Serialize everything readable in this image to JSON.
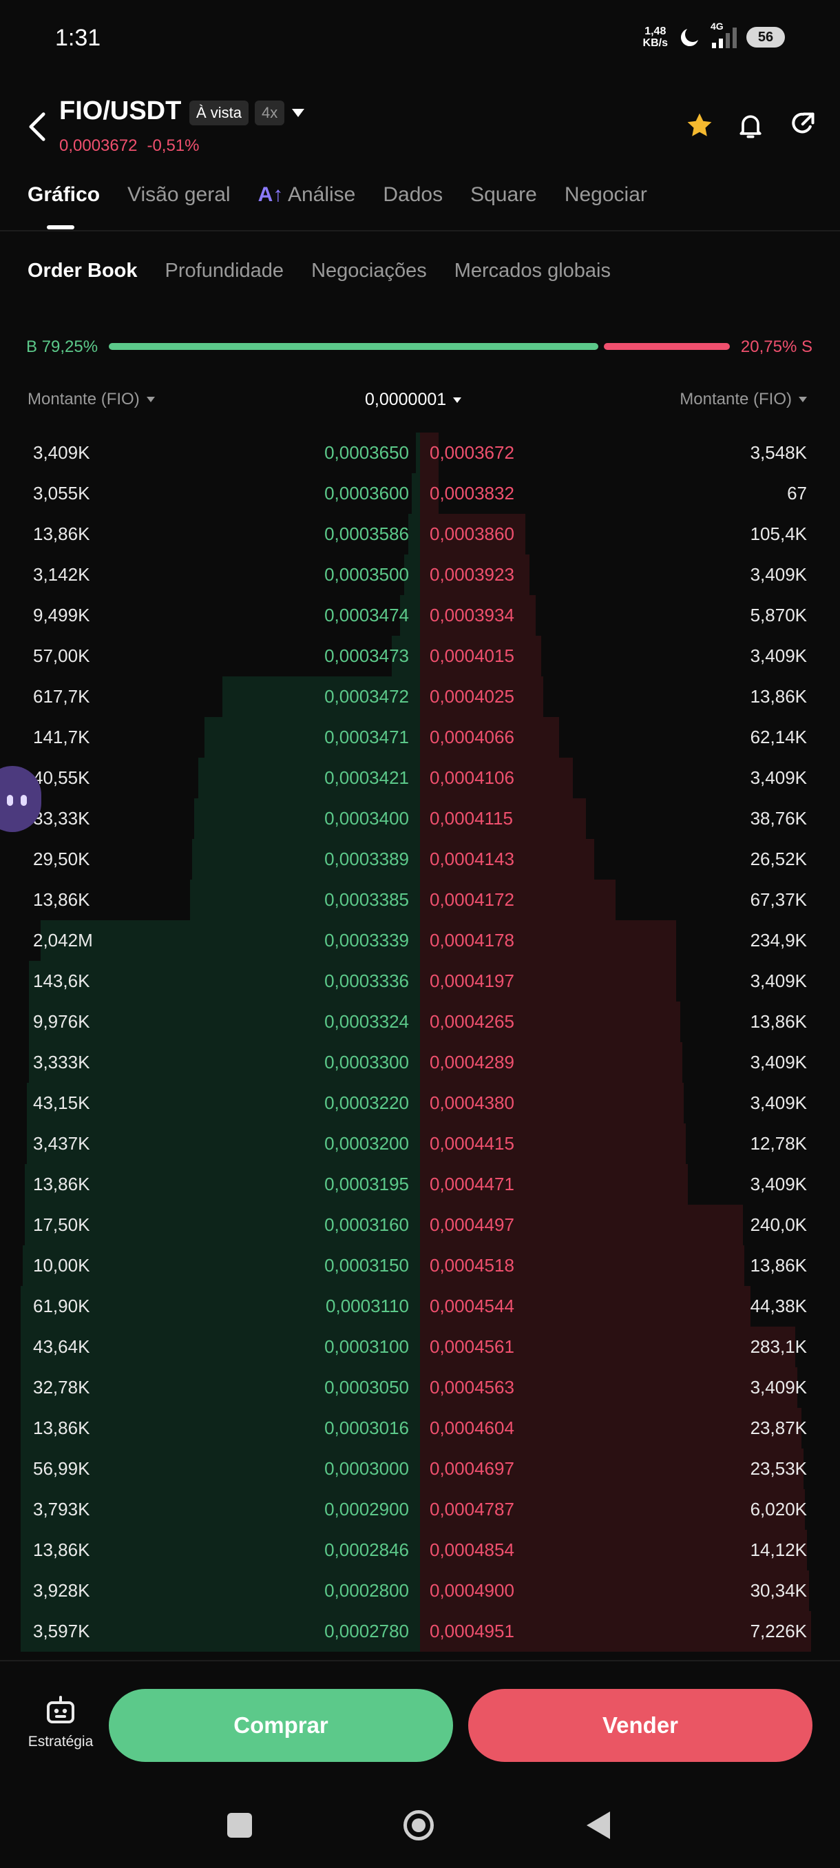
{
  "status_bar": {
    "time": "1:31",
    "net_speed_value": "1,48",
    "net_speed_unit": "KB/s",
    "network": "4G",
    "battery": "56",
    "icons": [
      "moon-icon",
      "signal-icon",
      "battery-icon"
    ]
  },
  "header": {
    "pair": "FIO/USDT",
    "market_badge": "À vista",
    "leverage_badge": "4x",
    "last_price": "0,0003672",
    "change": "-0,51%",
    "icons": [
      "back-icon",
      "star-icon",
      "bell-icon",
      "share-icon"
    ],
    "star_color": "#f5b92f"
  },
  "main_tabs": [
    {
      "label": "Gráfico",
      "active": true
    },
    {
      "label": "Visão geral",
      "active": false
    },
    {
      "label": "Análise",
      "active": false,
      "ai_prefix": "A↑"
    },
    {
      "label": "Dados",
      "active": false
    },
    {
      "label": "Square",
      "active": false
    },
    {
      "label": "Negociar",
      "active": false
    }
  ],
  "sub_tabs": [
    {
      "label": "Order Book",
      "active": true
    },
    {
      "label": "Profundidade",
      "active": false
    },
    {
      "label": "Negociações",
      "active": false
    },
    {
      "label": "Mercados globais",
      "active": false
    }
  ],
  "ratio": {
    "buy_label": "B 79,25%",
    "sell_label": "20,75% S",
    "buy_fraction": 0.7925
  },
  "columns": {
    "left": "Montante (FIO)",
    "precision": "0,0000001",
    "right": "Montante (FIO)"
  },
  "order_book": {
    "rows": [
      {
        "bid_amount": "3,409K",
        "bid_price": "0,0003650",
        "ask_price": "0,0003672",
        "ask_amount": "3,548K",
        "bid_depth": 0.01,
        "ask_depth": 0.048
      },
      {
        "bid_amount": "3,055K",
        "bid_price": "0,0003600",
        "ask_price": "0,0003832",
        "ask_amount": "67",
        "bid_depth": 0.02,
        "ask_depth": 0.048
      },
      {
        "bid_amount": "13,86K",
        "bid_price": "0,0003586",
        "ask_price": "0,0003860",
        "ask_amount": "105,4K",
        "bid_depth": 0.03,
        "ask_depth": 0.27
      },
      {
        "bid_amount": "3,142K",
        "bid_price": "0,0003500",
        "ask_price": "0,0003923",
        "ask_amount": "3,409K",
        "bid_depth": 0.04,
        "ask_depth": 0.28
      },
      {
        "bid_amount": "9,499K",
        "bid_price": "0,0003474",
        "ask_price": "0,0003934",
        "ask_amount": "5,870K",
        "bid_depth": 0.05,
        "ask_depth": 0.295
      },
      {
        "bid_amount": "57,00K",
        "bid_price": "0,0003473",
        "ask_price": "0,0004015",
        "ask_amount": "3,409K",
        "bid_depth": 0.07,
        "ask_depth": 0.31
      },
      {
        "bid_amount": "617,7K",
        "bid_price": "0,0003472",
        "ask_price": "0,0004025",
        "ask_amount": "13,86K",
        "bid_depth": 0.495,
        "ask_depth": 0.315
      },
      {
        "bid_amount": "141,7K",
        "bid_price": "0,0003471",
        "ask_price": "0,0004066",
        "ask_amount": "62,14K",
        "bid_depth": 0.54,
        "ask_depth": 0.355
      },
      {
        "bid_amount": "40,55K",
        "bid_price": "0,0003421",
        "ask_price": "0,0004106",
        "ask_amount": "3,409K",
        "bid_depth": 0.555,
        "ask_depth": 0.39
      },
      {
        "bid_amount": "33,33K",
        "bid_price": "0,0003400",
        "ask_price": "0,0004115",
        "ask_amount": "38,76K",
        "bid_depth": 0.565,
        "ask_depth": 0.425
      },
      {
        "bid_amount": "29,50K",
        "bid_price": "0,0003389",
        "ask_price": "0,0004143",
        "ask_amount": "26,52K",
        "bid_depth": 0.57,
        "ask_depth": 0.445
      },
      {
        "bid_amount": "13,86K",
        "bid_price": "0,0003385",
        "ask_price": "0,0004172",
        "ask_amount": "67,37K",
        "bid_depth": 0.575,
        "ask_depth": 0.5
      },
      {
        "bid_amount": "2,042M",
        "bid_price": "0,0003339",
        "ask_price": "0,0004178",
        "ask_amount": "234,9K",
        "bid_depth": 0.95,
        "ask_depth": 0.655
      },
      {
        "bid_amount": "143,6K",
        "bid_price": "0,0003336",
        "ask_price": "0,0004197",
        "ask_amount": "3,409K",
        "bid_depth": 0.98,
        "ask_depth": 0.655
      },
      {
        "bid_amount": "9,976K",
        "bid_price": "0,0003324",
        "ask_price": "0,0004265",
        "ask_amount": "13,86K",
        "bid_depth": 0.98,
        "ask_depth": 0.665
      },
      {
        "bid_amount": "3,333K",
        "bid_price": "0,0003300",
        "ask_price": "0,0004289",
        "ask_amount": "3,409K",
        "bid_depth": 0.98,
        "ask_depth": 0.67
      },
      {
        "bid_amount": "43,15K",
        "bid_price": "0,0003220",
        "ask_price": "0,0004380",
        "ask_amount": "3,409K",
        "bid_depth": 0.985,
        "ask_depth": 0.675
      },
      {
        "bid_amount": "3,437K",
        "bid_price": "0,0003200",
        "ask_price": "0,0004415",
        "ask_amount": "12,78K",
        "bid_depth": 0.985,
        "ask_depth": 0.68
      },
      {
        "bid_amount": "13,86K",
        "bid_price": "0,0003195",
        "ask_price": "0,0004471",
        "ask_amount": "3,409K",
        "bid_depth": 0.99,
        "ask_depth": 0.685
      },
      {
        "bid_amount": "17,50K",
        "bid_price": "0,0003160",
        "ask_price": "0,0004497",
        "ask_amount": "240,0K",
        "bid_depth": 0.99,
        "ask_depth": 0.825
      },
      {
        "bid_amount": "10,00K",
        "bid_price": "0,0003150",
        "ask_price": "0,0004518",
        "ask_amount": "13,86K",
        "bid_depth": 0.995,
        "ask_depth": 0.83
      },
      {
        "bid_amount": "61,90K",
        "bid_price": "0,0003110",
        "ask_price": "0,0004544",
        "ask_amount": "44,38K",
        "bid_depth": 1.0,
        "ask_depth": 0.845
      },
      {
        "bid_amount": "43,64K",
        "bid_price": "0,0003100",
        "ask_price": "0,0004561",
        "ask_amount": "283,1K",
        "bid_depth": 1.0,
        "ask_depth": 0.96
      },
      {
        "bid_amount": "32,78K",
        "bid_price": "0,0003050",
        "ask_price": "0,0004563",
        "ask_amount": "3,409K",
        "bid_depth": 1.0,
        "ask_depth": 0.965
      },
      {
        "bid_amount": "13,86K",
        "bid_price": "0,0003016",
        "ask_price": "0,0004604",
        "ask_amount": "23,87K",
        "bid_depth": 1.0,
        "ask_depth": 0.975
      },
      {
        "bid_amount": "56,99K",
        "bid_price": "0,0003000",
        "ask_price": "0,0004697",
        "ask_amount": "23,53K",
        "bid_depth": 1.0,
        "ask_depth": 0.98
      },
      {
        "bid_amount": "3,793K",
        "bid_price": "0,0002900",
        "ask_price": "0,0004787",
        "ask_amount": "6,020K",
        "bid_depth": 1.0,
        "ask_depth": 0.985
      },
      {
        "bid_amount": "13,86K",
        "bid_price": "0,0002846",
        "ask_price": "0,0004854",
        "ask_amount": "14,12K",
        "bid_depth": 1.0,
        "ask_depth": 0.99
      },
      {
        "bid_amount": "3,928K",
        "bid_price": "0,0002800",
        "ask_price": "0,0004900",
        "ask_amount": "30,34K",
        "bid_depth": 1.0,
        "ask_depth": 0.995
      },
      {
        "bid_amount": "3,597K",
        "bid_price": "0,0002780",
        "ask_price": "0,0004951",
        "ask_amount": "7,226K",
        "bid_depth": 1.0,
        "ask_depth": 1.0
      }
    ]
  },
  "bottom_bar": {
    "strategy_label": "Estratégia",
    "buy_label": "Comprar",
    "sell_label": "Vender",
    "icons": [
      "robot-icon"
    ]
  },
  "nav_bar": {
    "icons": [
      "recents-square-icon",
      "home-circle-icon",
      "back-triangle-icon"
    ]
  },
  "colors": {
    "background": "#0b0b0b",
    "bid": "#5cc98a",
    "ask": "#f0506e",
    "bid_depth": "#0d241a",
    "ask_depth": "#2a1012"
  }
}
